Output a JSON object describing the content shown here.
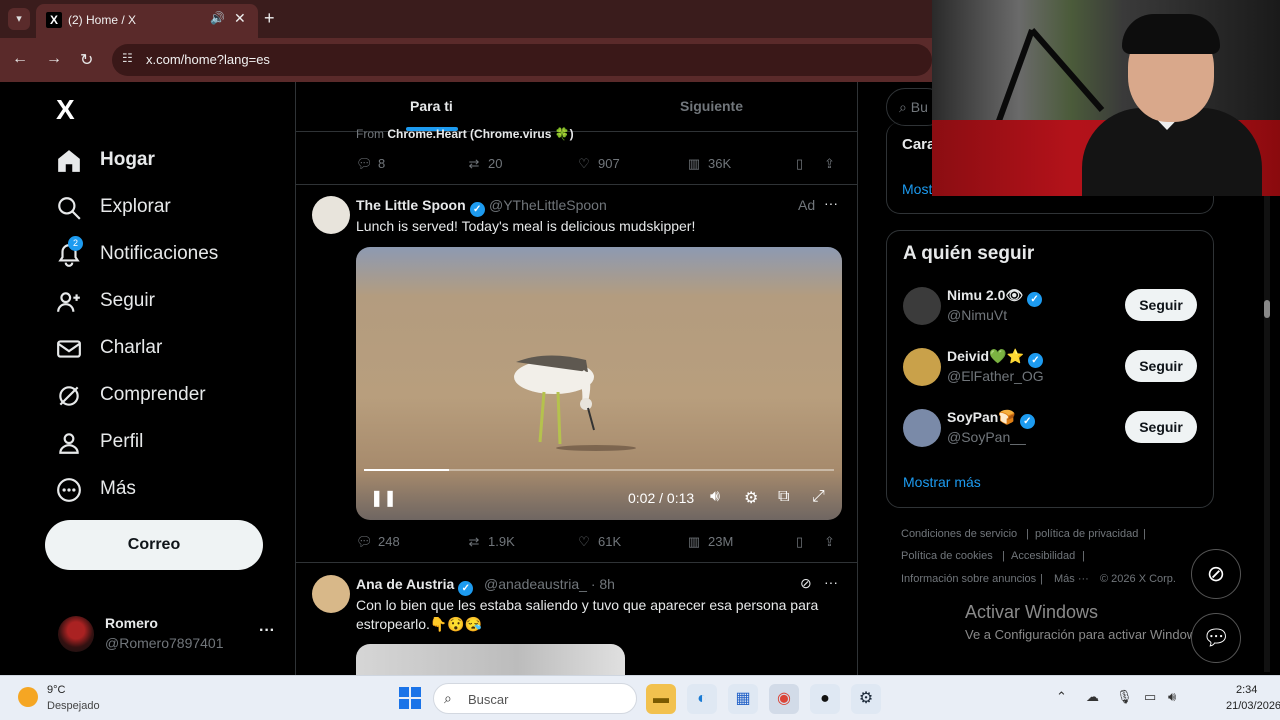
{
  "browser": {
    "tab_title": "(2) Home / X",
    "tab_favicon": "X",
    "url": "x.com/home?lang=es"
  },
  "sidebar": {
    "logo": "X",
    "items": [
      {
        "label": "Hogar",
        "icon": "home-icon",
        "active": true
      },
      {
        "label": "Explorar",
        "icon": "search-icon"
      },
      {
        "label": "Notificaciones",
        "icon": "bell-icon",
        "badge": "2"
      },
      {
        "label": "Seguir",
        "icon": "add-person-icon"
      },
      {
        "label": "Charlar",
        "icon": "mail-icon"
      },
      {
        "label": "Comprender",
        "icon": "grok-icon"
      },
      {
        "label": "Perfil",
        "icon": "person-icon"
      },
      {
        "label": "Más",
        "icon": "more-circle-icon"
      }
    ],
    "post_button": "Correo",
    "profile": {
      "name": "Romero",
      "handle": "@Romero7897401",
      "more": "···"
    }
  },
  "feed": {
    "tabs": [
      {
        "label": "Para ti",
        "active": true
      },
      {
        "label": "Siguiente"
      }
    ],
    "prev_post": {
      "from_prefix": "From",
      "from_name": "Chrome.Heart (Chrome.virus 🍀)",
      "replies": "8",
      "reposts": "20",
      "likes": "907",
      "views": "36K"
    },
    "ad_post": {
      "name": "The Little Spoon",
      "handle": "@YTheLittleSpoon",
      "ad_label": "Ad",
      "text": "Lunch is served! Today's meal is delicious mudskipper!",
      "video_time": "0:02 / 0:13",
      "video_progress": 0.18,
      "replies": "248",
      "reposts": "1.9K",
      "likes": "61K",
      "views": "23M"
    },
    "next_post": {
      "name": "Ana de Austria",
      "handle": "@anadeaustria_ · 8h",
      "text": "Con lo bien que les estaba saliendo y tuvo que aparecer esa persona para estropearlo.👇😯😪"
    }
  },
  "right": {
    "search_placeholder": "Bu",
    "trend_title": "Cara",
    "trend_more": "Most",
    "who_to_follow": {
      "title": "A quién seguir",
      "users": [
        {
          "name": "Nimu 2.0👁",
          "handle": "@NimuVt",
          "button": "Seguir",
          "color": "#3b3b3b"
        },
        {
          "name": "Deivid💚⭐",
          "handle": "@ElFather_OG",
          "button": "Seguir",
          "color": "#c9a14a"
        },
        {
          "name": "SoyPan🍞",
          "handle": "@SoyPan__",
          "button": "Seguir",
          "color": "#7a8aa8"
        }
      ],
      "show_more": "Mostrar más"
    },
    "footer": {
      "terms": "Condiciones de servicio",
      "privacy": "política de privacidad",
      "cookies": "Política de cookies",
      "accessibility": "Accesibilidad",
      "ads": "Información sobre anuncios",
      "more": "Más ···",
      "copyright": "© 2026 X Corp."
    },
    "activate_windows": {
      "title": "Activar Windows",
      "subtitle": "Ve a Configuración para activar Windows."
    }
  },
  "taskbar": {
    "weather_temp": "9°C",
    "weather_desc": "Despejado",
    "search_placeholder": "Buscar",
    "time": "2:34",
    "date": "21/03/2026"
  },
  "colors": {
    "accent": "#1d9bf0",
    "background": "#000000",
    "tab_bar": "#3a1c1c"
  }
}
